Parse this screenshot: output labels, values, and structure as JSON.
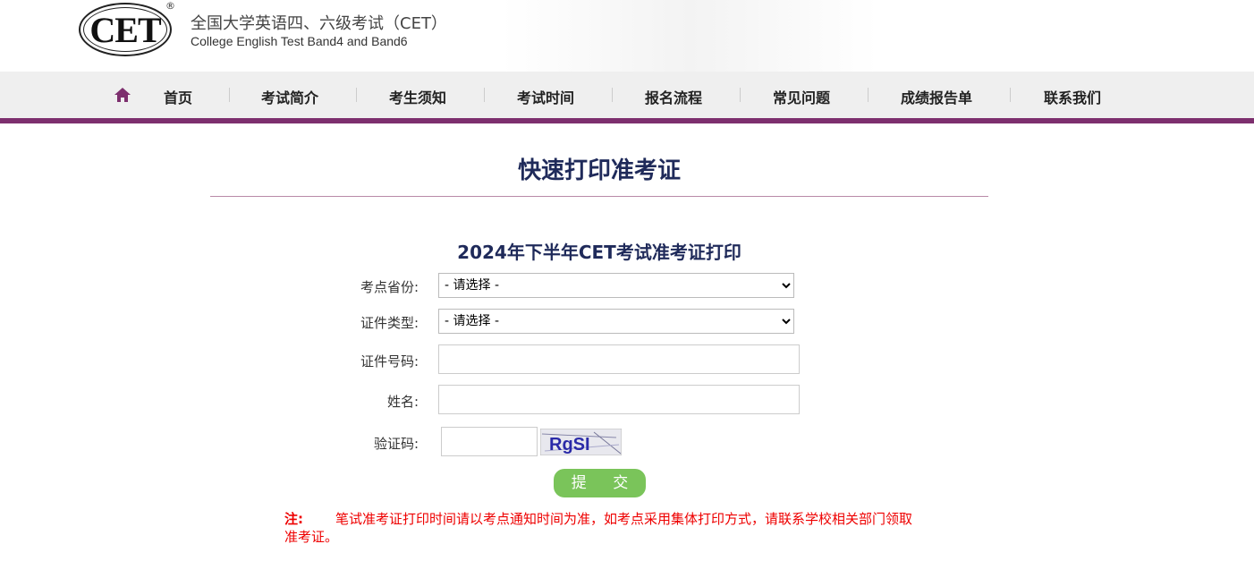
{
  "header": {
    "logo_text": "CET",
    "title_cn": "全国大学英语四、六级考试（CET）",
    "title_en": "College English Test Band4 and Band6"
  },
  "nav": {
    "items": [
      "首页",
      "考试简介",
      "考生须知",
      "考试时间",
      "报名流程",
      "常见问题",
      "成绩报告单",
      "联系我们"
    ],
    "accent": "#7d2f6e"
  },
  "page_title": "快速打印准考证",
  "form": {
    "title": "2024年下半年CET考试准考证打印",
    "province_label": "考点省份:",
    "province_value": "- 请选择 -",
    "idtype_label": "证件类型:",
    "idtype_value": "- 请选择 -",
    "idnum_label": "证件号码:",
    "name_label": "姓名:",
    "captcha_label": "验证码:",
    "captcha_code": "RgSI",
    "submit": "提 交"
  },
  "note": {
    "label": "注:",
    "text": "笔试准考证打印时间请以考点通知时间为准，如考点采用集体打印方式，请联系学校相关部门领取准考证。"
  }
}
